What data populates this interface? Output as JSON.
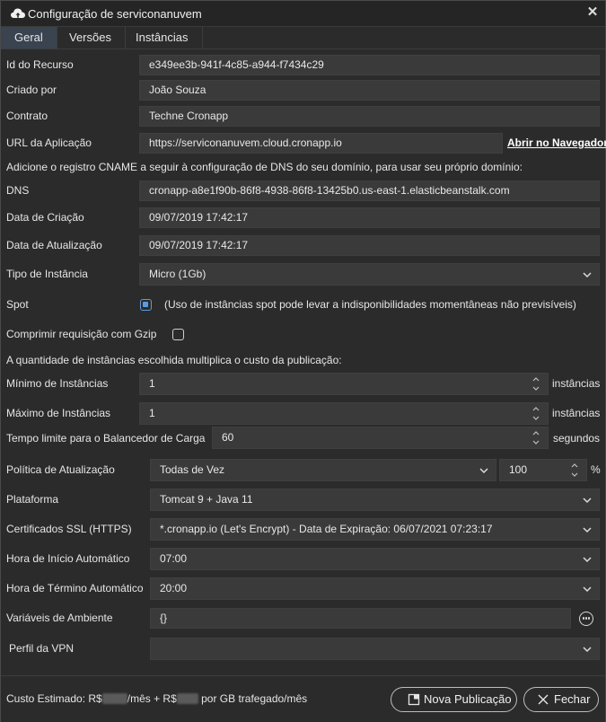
{
  "window": {
    "title": "Configuração de serviconanuvem"
  },
  "tabs": [
    {
      "label": "Geral"
    },
    {
      "label": "Versões"
    },
    {
      "label": "Instâncias"
    }
  ],
  "fields": {
    "resource_id": {
      "label": "Id do Recurso",
      "value": "e349ee3b-941f-4c85-a944-f7434c29"
    },
    "created_by": {
      "label": "Criado por",
      "value": "João Souza"
    },
    "contract": {
      "label": "Contrato",
      "value": "Techne Cronapp"
    },
    "app_url": {
      "label": "URL da Aplicação",
      "value": "https://serviconanuvem.cloud.cronapp.io",
      "link": "Abrir no Navegador"
    },
    "cname_note": "Adicione o registro CNAME a seguir à configuração de DNS do seu domínio, para usar seu próprio domínio:",
    "dns": {
      "label": "DNS",
      "value": "cronapp-a8e1f90b-86f8-4938-86f8-13425b0.us-east-1.elasticbeanstalk.com"
    },
    "created_at": {
      "label": "Data de Criação",
      "value": "09/07/2019 17:42:17"
    },
    "updated_at": {
      "label": "Data de Atualização",
      "value": "09/07/2019 17:42:17"
    },
    "instance_type": {
      "label": "Tipo de Instância",
      "value": "Micro (1Gb)"
    },
    "spot": {
      "label": "Spot",
      "note": "(Uso de instâncias spot pode levar a indisponibilidades momentâneas não previsíveis)",
      "checked": true
    },
    "gzip": {
      "label": "Comprimir requisição com Gzip",
      "checked": false
    },
    "instances_note": "A quantidade de instâncias escolhida multiplica o custo da publicação:",
    "min_instances": {
      "label": "Mínimo de Instâncias",
      "value": "1",
      "unit": "instâncias"
    },
    "max_instances": {
      "label": "Máximo de Instâncias",
      "value": "1",
      "unit": "instâncias"
    },
    "lb_timeout": {
      "label": "Tempo limite para o Balancedor de Carga",
      "value": "60",
      "unit": "segundos"
    },
    "update_policy": {
      "label": "Política de Atualização",
      "value": "Todas de Vez",
      "percent": "100",
      "percent_sign": "%"
    },
    "platform": {
      "label": "Plataforma",
      "value": "Tomcat 9 + Java 11"
    },
    "ssl": {
      "label": "Certificados SSL (HTTPS)",
      "value": "*.cronapp.io (Let's Encrypt) - Data de Expiração: 06/07/2021 07:23:17"
    },
    "auto_start": {
      "label": "Hora de Início Automático",
      "value": "07:00"
    },
    "auto_stop": {
      "label": "Hora de Término Automático",
      "value": "20:00"
    },
    "env_vars": {
      "label": "Variáveis de Ambiente",
      "value": "{}"
    },
    "vpn": {
      "label": "Perfil da VPN",
      "value": ""
    }
  },
  "footer": {
    "cost_label": "Custo Estimado:",
    "cost_prefix": "R$",
    "cost_month": "/mês + R$",
    "cost_gb": "por GB trafegado/mês",
    "new_publication": "Nova Publicação",
    "close": "Fechar"
  },
  "colors": {
    "accent": "#5b9be0",
    "background": "#2b2b2b",
    "field": "#3a3a3a",
    "active_tab": "#3a4350"
  },
  "icons": {
    "window": "cloud-upload-icon",
    "close": "close-icon",
    "select": "chevron-down-icon",
    "spinner": "spinner-arrows-icon",
    "more": "more-options-icon",
    "new": "new-publication-icon",
    "cancel": "cancel-x-icon"
  }
}
